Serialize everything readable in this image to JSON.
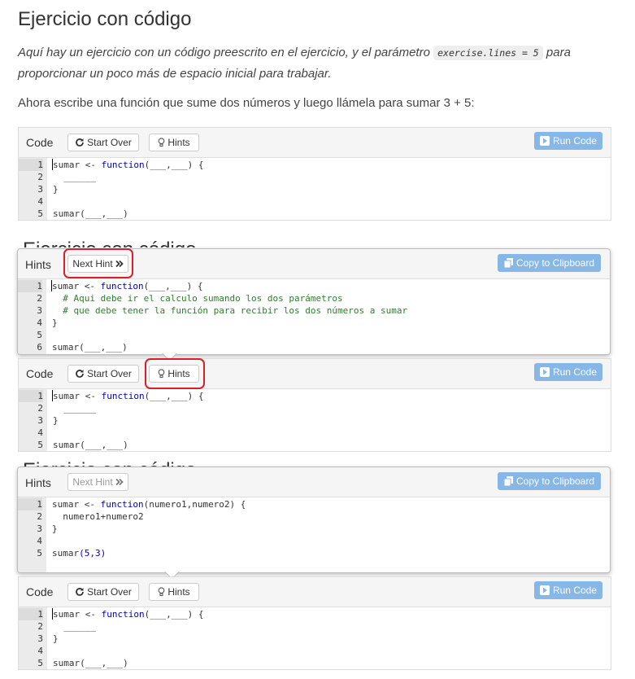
{
  "page": {
    "title": "Ejercicio con código",
    "intro_before": "Aquí hay un ejercicio con un código preescrito en el ejercicio, y el parámetro ",
    "intro_code": "exercise.lines = 5",
    "intro_after": " para proporcionar un poco más de espacio inicial para trabajar.",
    "task": "Ahora escribe una función que sume dos números y luego llámela para sumar 3 + 5:"
  },
  "labels": {
    "code": "Code",
    "hints": "Hints",
    "start_over": "Start Over",
    "hints_button": "Hints",
    "run_code": "Run Code",
    "next_hint": "Next Hint",
    "copy_clipboard": "Copy to Clipboard"
  },
  "icons": {
    "start_over": "refresh-icon",
    "hints": "lightbulb-icon",
    "run": "play-icon",
    "next": "double-chevron-right-icon",
    "copy": "copy-icon"
  },
  "exercise_code": {
    "line1_pre": "sumar <- ",
    "line1_kw": "function",
    "line1_post": "(___,___) {",
    "line2": "  ______",
    "line3": "}",
    "line4": "",
    "line5": "sumar(___,___)"
  },
  "hint1_code": {
    "line1_pre": "sumar <- ",
    "line1_kw": "function",
    "line1_post": "(___,___) {",
    "line2": "  # Aqui debe ir el calculo sumando los dos parámetros",
    "line3": "  # que debe tener la función para recibir los dos números a sumar",
    "line4": "}",
    "line5": "",
    "line6": "sumar(___,___)"
  },
  "hint2_code": {
    "line1_pre": "sumar <- ",
    "line1_kw": "function",
    "line1_post": "(numero1,numero2) {",
    "line2": "  numero1+numero2",
    "line3": "}",
    "line4": "",
    "line5_pre": "sumar",
    "line5_args": "(5,3)"
  },
  "line_numbers": [
    "1",
    "2",
    "3",
    "4",
    "5",
    "6"
  ],
  "colors": {
    "accent": "#86b7e6",
    "highlight": "#d9202a",
    "keyword": "#0000c8",
    "comment": "#2f7d2f"
  }
}
